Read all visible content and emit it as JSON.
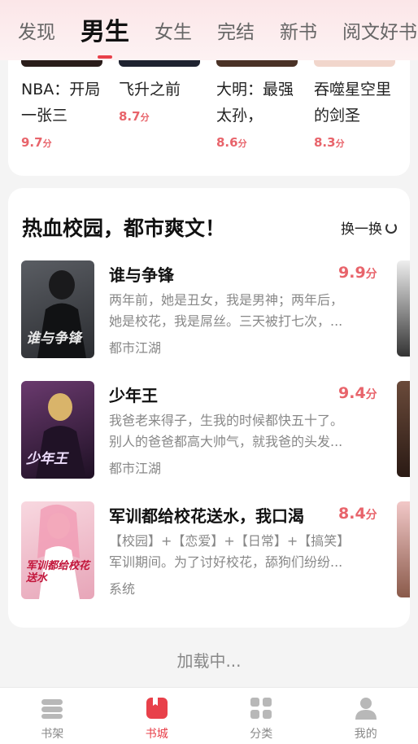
{
  "top_tabs": [
    "发现",
    "男生",
    "女生",
    "完结",
    "新书",
    "阅文好书"
  ],
  "active_tab": "男生",
  "card1": {
    "books": [
      {
        "title": "NBA：开局一张三",
        "score": "9.7",
        "unit": "分",
        "cover_color": "#2a1d1a"
      },
      {
        "title": "飞升之前",
        "score": "8.7",
        "unit": "分",
        "cover_color": "#1e2230"
      },
      {
        "title": "大明：最强太孙，",
        "score": "8.6",
        "unit": "分",
        "cover_color": "#4a3226"
      },
      {
        "title": "吞噬星空里的剑圣",
        "score": "8.3",
        "unit": "分",
        "cover_color": "#f1d6cc"
      }
    ]
  },
  "section": {
    "title": "热血校园，都市爽文！",
    "refresh_label": "换一换",
    "books": [
      {
        "title": "谁与争锋",
        "score": "9.9",
        "unit": "分",
        "desc_line1": "两年前，她是丑女，我是男神；两年后，",
        "desc_line2": "她是校花，我是屌丝。三天被打七次，...",
        "tag": "都市江湖",
        "cover_text": "谁与争锋",
        "cover_bg": "#3b3e44",
        "cover_text_color": "#e9e9e9"
      },
      {
        "title": "少年王",
        "score": "9.4",
        "unit": "分",
        "desc_line1": "我爸老来得子，生我的时候都快五十了。",
        "desc_line2": "别人的爸爸都高大帅气，就我爸的头发...",
        "tag": "都市江湖",
        "cover_text": "少年王",
        "cover_bg": "#3d2346",
        "cover_text_color": "#f0e0ff"
      },
      {
        "title": "军训都给校花送水，我口渴",
        "score": "8.4",
        "unit": "分",
        "desc_line1": "【校园】+【恋爱】+【日常】+【搞笑】",
        "desc_line2": "军训期间。为了讨好校花，舔狗们纷纷...",
        "tag": "系统",
        "cover_text": "军训都给校花送水",
        "cover_bg": "#f2c2cf",
        "cover_text_color": "#c2153a"
      }
    ]
  },
  "loading_text": "加载中...",
  "bottom_nav": [
    {
      "label": "书架",
      "icon": "bookshelf-icon"
    },
    {
      "label": "书城",
      "icon": "bookstore-icon"
    },
    {
      "label": "分类",
      "icon": "category-icon"
    },
    {
      "label": "我的",
      "icon": "profile-icon"
    }
  ],
  "active_nav": "书城",
  "colors": {
    "accent": "#e8404a",
    "score": "#e8646b",
    "muted": "#888888"
  }
}
